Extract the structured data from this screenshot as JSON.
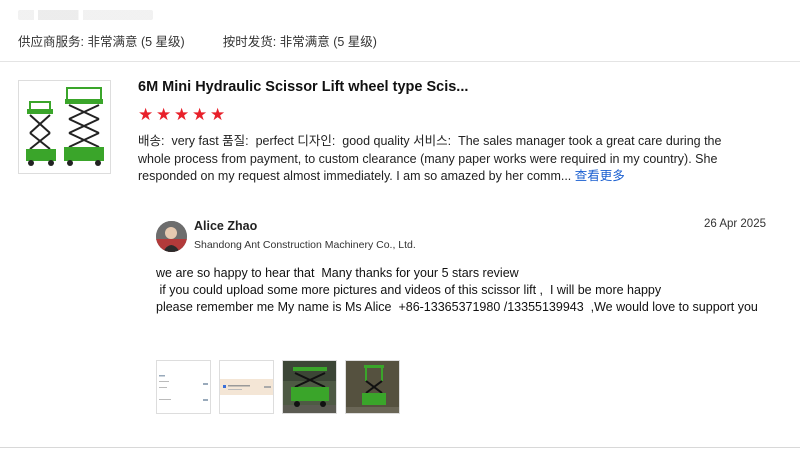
{
  "ratings": [
    {
      "label": "供应商服务:",
      "value": "非常满意",
      "stars": "(5 星级)"
    },
    {
      "label": "按时发货:",
      "value": "非常满意",
      "stars": "(5 星级)"
    }
  ],
  "product": {
    "title": "6M Mini Hydraulic Scissor Lift wheel type Scis...",
    "rating": 5
  },
  "review": {
    "k1": "배송:",
    "v1": "very fast",
    "k2": "품질:",
    "v2": "perfect",
    "k3": "디자인:",
    "v3": "good quality",
    "k4": "서비스:",
    "v4": "The sales manager took a great care during the whole process from payment, to custom clearance (many paper works were required in my country). She responded on my request almost immediately. I am so amazed by her comm...",
    "see_more": "查看更多"
  },
  "reply": {
    "name": "Alice Zhao",
    "company": "Shandong Ant Construction Machinery Co., Ltd.",
    "date": "26 Apr 2025",
    "body": "we are so happy to hear that  Many thanks for your 5 stars review\n if you could upload some more pictures and videos of this scissor lift ,  I will be more happy\nplease remember me My name is Ms Alice  +86-13365371980 /13355139943  ,We would love to support you"
  },
  "colors": {
    "star": "#e8202a",
    "link": "#1a5fd0",
    "lift_green": "#3aa52a"
  },
  "icons": [
    "star-icon"
  ]
}
